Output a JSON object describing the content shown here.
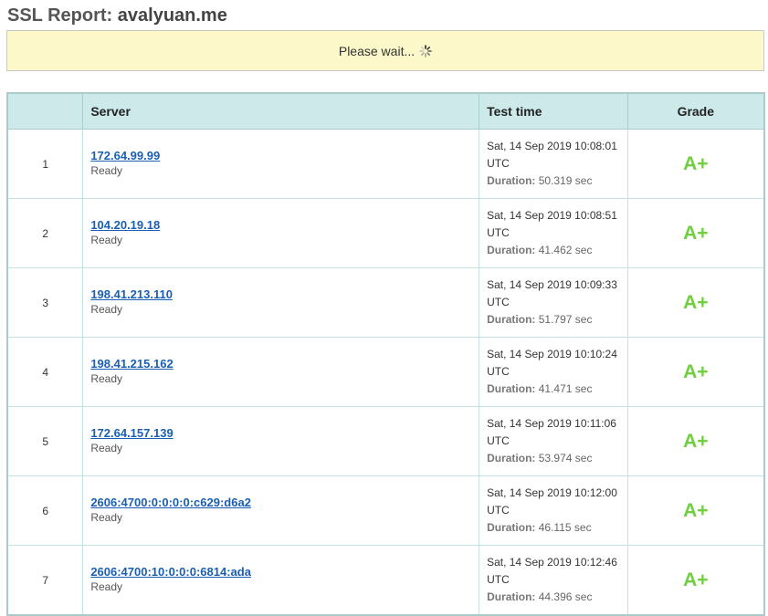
{
  "header": {
    "prefix": "SSL Report: ",
    "host": "avalyuan.me"
  },
  "status": {
    "text": "Please wait..."
  },
  "table": {
    "columns": [
      "",
      "Server",
      "Test time",
      "Grade"
    ],
    "rows": [
      {
        "num": "1",
        "ip": "172.64.99.99",
        "status": "Ready",
        "time": "Sat, 14 Sep 2019 10:08:01",
        "tz": "UTC",
        "duration_label": "Duration:",
        "duration": "50.319 sec",
        "grade": "A+"
      },
      {
        "num": "2",
        "ip": "104.20.19.18",
        "status": "Ready",
        "time": "Sat, 14 Sep 2019 10:08:51",
        "tz": "UTC",
        "duration_label": "Duration:",
        "duration": "41.462 sec",
        "grade": "A+"
      },
      {
        "num": "3",
        "ip": "198.41.213.110",
        "status": "Ready",
        "time": "Sat, 14 Sep 2019 10:09:33",
        "tz": "UTC",
        "duration_label": "Duration:",
        "duration": "51.797 sec",
        "grade": "A+"
      },
      {
        "num": "4",
        "ip": "198.41.215.162",
        "status": "Ready",
        "time": "Sat, 14 Sep 2019 10:10:24",
        "tz": "UTC",
        "duration_label": "Duration:",
        "duration": "41.471 sec",
        "grade": "A+"
      },
      {
        "num": "5",
        "ip": "172.64.157.139",
        "status": "Ready",
        "time": "Sat, 14 Sep 2019 10:11:06",
        "tz": "UTC",
        "duration_label": "Duration:",
        "duration": "53.974 sec",
        "grade": "A+"
      },
      {
        "num": "6",
        "ip": "2606:4700:0:0:0:0:c629:d6a2",
        "status": "Ready",
        "time": "Sat, 14 Sep 2019 10:12:00",
        "tz": "UTC",
        "duration_label": "Duration:",
        "duration": "46.115 sec",
        "grade": "A+"
      },
      {
        "num": "7",
        "ip": "2606:4700:10:0:0:0:6814:ada",
        "status": "Ready",
        "time": "Sat, 14 Sep 2019 10:12:46",
        "tz": "UTC",
        "duration_label": "Duration:",
        "duration": "44.396 sec",
        "grade": "A+"
      }
    ]
  },
  "colors": {
    "grade_green": "#6fcf3f",
    "link_blue": "#1a5fb4",
    "header_teal": "#cde9ea",
    "wait_yellow": "#fdf8c9"
  }
}
